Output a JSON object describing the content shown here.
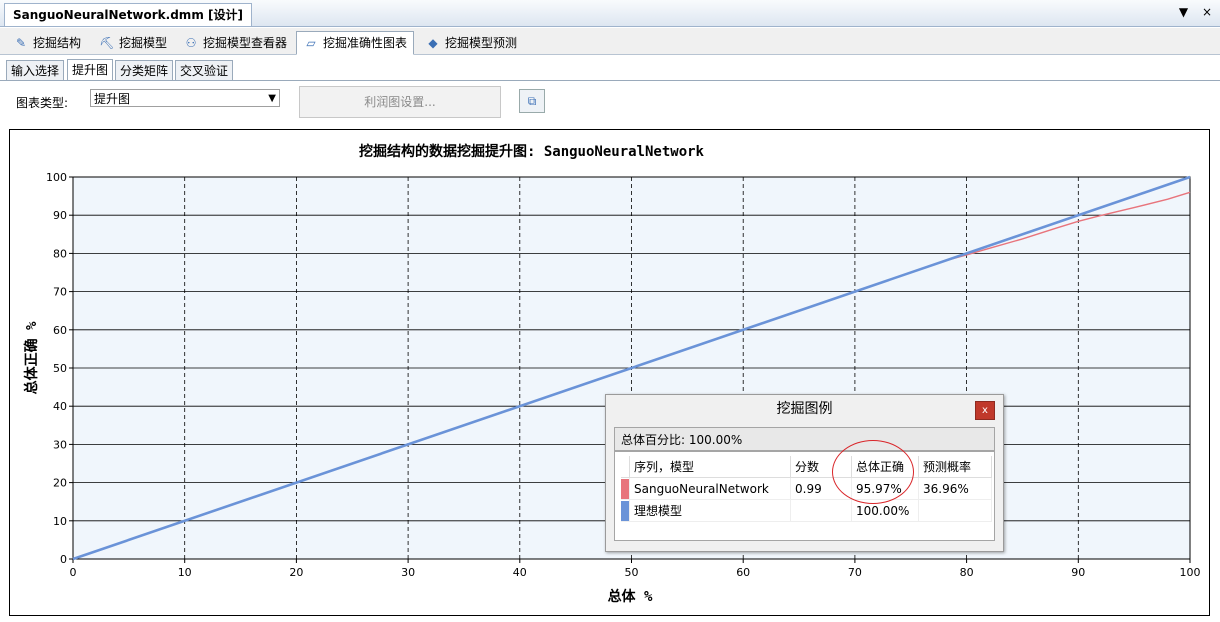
{
  "window": {
    "doc_tab": "SanguoNeuralNetwork.dmm [设计]",
    "controls": [
      "▼",
      "×"
    ]
  },
  "main_tabs": [
    {
      "label": "挖掘结构",
      "icon": "mining-structure-icon"
    },
    {
      "label": "挖掘模型",
      "icon": "mining-model-icon"
    },
    {
      "label": "挖掘模型查看器",
      "icon": "model-viewer-icon"
    },
    {
      "label": "挖掘准确性图表",
      "icon": "accuracy-chart-icon",
      "active": true
    },
    {
      "label": "挖掘模型预测",
      "icon": "prediction-gem-icon"
    }
  ],
  "sub_tabs": [
    {
      "label": "输入选择"
    },
    {
      "label": "提升图",
      "active": true
    },
    {
      "label": "分类矩阵"
    },
    {
      "label": "交叉验证"
    }
  ],
  "toolbar": {
    "chart_type_label": "图表类型:",
    "chart_type_value": "提升图",
    "lift_settings_label": "利润图设置..."
  },
  "chart_data": {
    "type": "line",
    "title": "挖掘结构的数据挖掘提升图: SanguoNeuralNetwork",
    "xlabel": "总体 %",
    "ylabel": "总体正确 %",
    "xlim": [
      0,
      100
    ],
    "ylim": [
      0,
      100
    ],
    "x_ticks": [
      0,
      10,
      20,
      30,
      40,
      50,
      60,
      70,
      80,
      90,
      100
    ],
    "y_ticks": [
      0,
      10,
      20,
      30,
      40,
      50,
      60,
      70,
      80,
      90,
      100
    ],
    "grid": true,
    "series": [
      {
        "name": "SanguoNeuralNetwork",
        "color": "#e8747c",
        "x": [
          0,
          10,
          20,
          30,
          40,
          50,
          60,
          70,
          78,
          80,
          82,
          85,
          88,
          90,
          92,
          95,
          98,
          100
        ],
        "y": [
          0,
          10,
          20,
          30,
          40,
          50,
          60,
          70,
          78,
          79.6,
          81.3,
          83.8,
          86.6,
          88.4,
          89.9,
          92.0,
          94.2,
          96.0
        ]
      },
      {
        "name": "理想模型",
        "color": "#6a93d8",
        "x": [
          0,
          100
        ],
        "y": [
          0,
          100
        ]
      }
    ]
  },
  "legend": {
    "title": "挖掘图例",
    "close": "x",
    "population": "总体百分比: 100.00%",
    "headers": [
      "序列，模型",
      "分数",
      "总体正确",
      "预测概率"
    ],
    "rows": [
      {
        "color": "#e8747c",
        "name": "SanguoNeuralNetwork",
        "score": "0.99",
        "correct": "95.97%",
        "prob": "36.96%"
      },
      {
        "color": "#6a93d8",
        "name": "理想模型",
        "score": "",
        "correct": "100.00%",
        "prob": ""
      }
    ]
  }
}
